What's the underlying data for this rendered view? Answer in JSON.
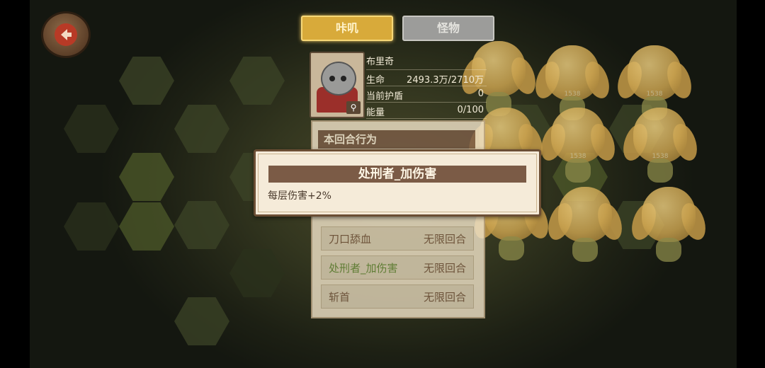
{
  "nav": {
    "back_icon": "back-arrow-icon"
  },
  "tabs": [
    {
      "label": "咔叽",
      "active": true
    },
    {
      "label": "怪物",
      "active": false
    }
  ],
  "character": {
    "name": "布里奇",
    "stats": [
      {
        "key": "生命",
        "value": "2493.3万/2710万"
      },
      {
        "key": "当前护盾",
        "value": "0"
      },
      {
        "key": "能量",
        "value": "0/100"
      }
    ],
    "zoom_icon": "magnifier-icon"
  },
  "panel": {
    "header": "本回合行为",
    "buffs": [
      {
        "name": "刀口舔血",
        "duration": "无限回合"
      },
      {
        "name": "处刑者_加伤害",
        "duration": "无限回合"
      },
      {
        "name": "斩首",
        "duration": "无限回合"
      }
    ]
  },
  "tooltip": {
    "title": "处刑者_加伤害",
    "description": "每层伤害+2%"
  },
  "enemies": {
    "hp_label": "1538"
  },
  "colors": {
    "active_tab": "#d8aa3a",
    "inactive_tab": "#9c9c9a",
    "panel_header": "#7b5d47",
    "buff_green": "#6a8d3a"
  }
}
